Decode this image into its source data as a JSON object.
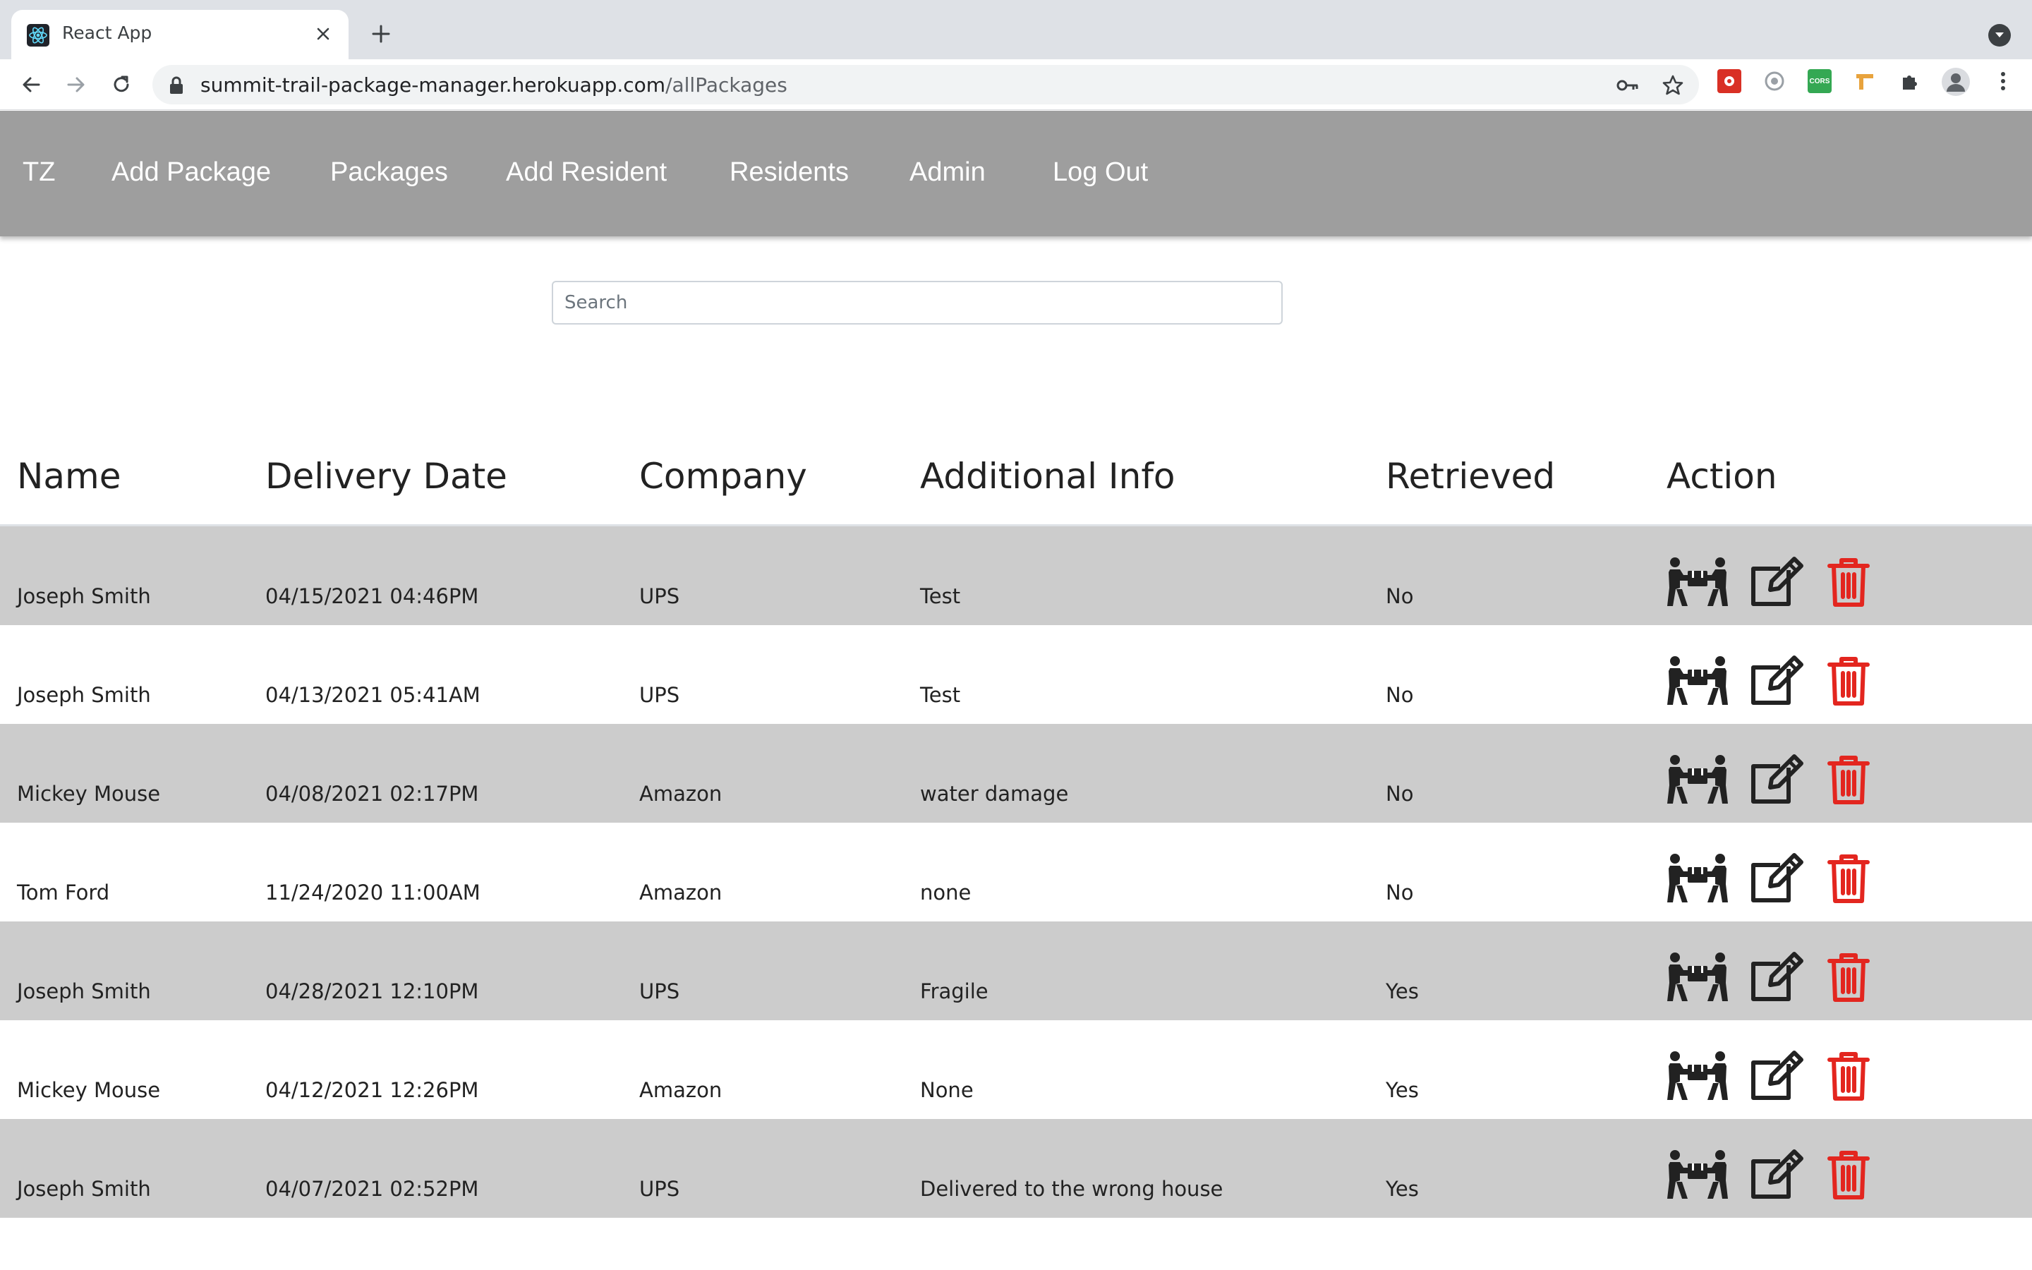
{
  "browser": {
    "tab_title": "React App",
    "url_host": "summit-trail-package-manager.herokuapp.com",
    "url_path": "/allPackages",
    "extensions": [
      {
        "name": "red-extension-icon",
        "color": "#d93025"
      },
      {
        "name": "circle-extension-icon",
        "color": "#9aa0a6"
      },
      {
        "name": "cors-extension-icon",
        "color": "#34a853",
        "label": "CORS"
      },
      {
        "name": "tool-extension-icon",
        "color": "#e8a33d"
      }
    ]
  },
  "nav": {
    "brand": "TZ",
    "items": [
      "Add Package",
      "Packages",
      "Add Resident",
      "Residents",
      "Admin",
      "Log Out"
    ]
  },
  "search": {
    "placeholder": "Search"
  },
  "table": {
    "headers": {
      "name": "Name",
      "delivery_date": "Delivery Date",
      "company": "Company",
      "additional_info": "Additional Info",
      "retrieved": "Retrieved",
      "action": "Action"
    },
    "rows": [
      {
        "name": "Joseph Smith",
        "delivery_date": "04/15/2021 04:46PM",
        "company": "UPS",
        "additional_info": "Test",
        "retrieved": "No"
      },
      {
        "name": "Joseph Smith",
        "delivery_date": "04/13/2021 05:41AM",
        "company": "UPS",
        "additional_info": "Test",
        "retrieved": "No"
      },
      {
        "name": "Mickey Mouse",
        "delivery_date": "04/08/2021 02:17PM",
        "company": "Amazon",
        "additional_info": "water damage",
        "retrieved": "No"
      },
      {
        "name": "Tom Ford",
        "delivery_date": "11/24/2020 11:00AM",
        "company": "Amazon",
        "additional_info": "none",
        "retrieved": "No"
      },
      {
        "name": "Joseph Smith",
        "delivery_date": "04/28/2021 12:10PM",
        "company": "UPS",
        "additional_info": "Fragile",
        "retrieved": "Yes"
      },
      {
        "name": "Mickey Mouse",
        "delivery_date": "04/12/2021 12:26PM",
        "company": "Amazon",
        "additional_info": "None",
        "retrieved": "Yes"
      },
      {
        "name": "Joseph Smith",
        "delivery_date": "04/07/2021 02:52PM",
        "company": "UPS",
        "additional_info": "Delivered to the wrong house",
        "retrieved": "Yes"
      }
    ],
    "actions": [
      {
        "name": "people-carry-icon",
        "color": "#222222"
      },
      {
        "name": "edit-icon",
        "color": "#222222"
      },
      {
        "name": "trash-icon",
        "color": "#e3261f"
      }
    ]
  },
  "colors": {
    "nav_background": "#9e9e9e",
    "row_alternate": "#cccccc",
    "delete_red": "#e3261f"
  }
}
